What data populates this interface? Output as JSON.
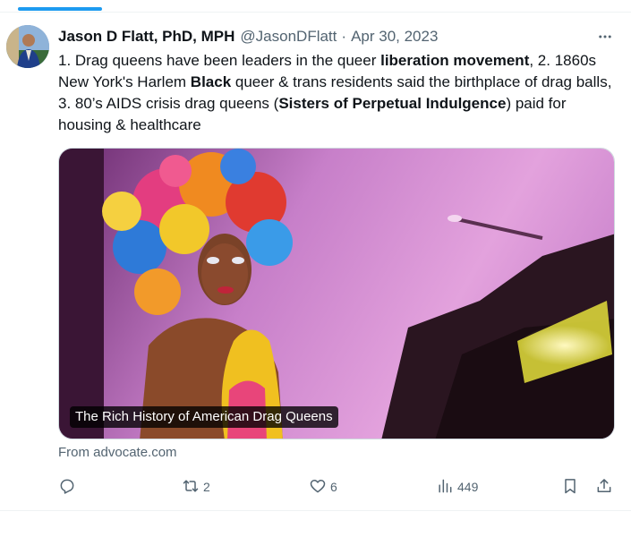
{
  "tweet": {
    "author": {
      "display_name": "Jason D Flatt, PhD, MPH",
      "handle": "@JasonDFlatt",
      "separator": "·",
      "date": "Apr 30, 2023"
    },
    "text": {
      "p1": "1. Drag queens have been leaders in the queer ",
      "b1": "liberation movement",
      "p2": ", 2. 1860s New York's Harlem ",
      "b2": "Black",
      "p3": " queer & trans residents said the birthplace of drag balls, 3. 80’s AIDS crisis drag queens (",
      "b3": "Sisters of Perpetual Indulgence",
      "p4": ") paid for housing & healthcare"
    },
    "card": {
      "title": "The Rich History of American Drag Queens",
      "source": "From advocate.com"
    },
    "actions": {
      "replies": "",
      "reposts": "2",
      "likes": "6",
      "views": "449"
    },
    "icons": {
      "more": "more-horizontal-icon",
      "reply": "reply-icon",
      "repost": "repost-icon",
      "like": "heart-icon",
      "views": "views-icon",
      "bookmark": "bookmark-icon",
      "share": "share-icon"
    },
    "colors": {
      "accent": "#1d9bf0",
      "secondary_text": "#536471"
    }
  }
}
